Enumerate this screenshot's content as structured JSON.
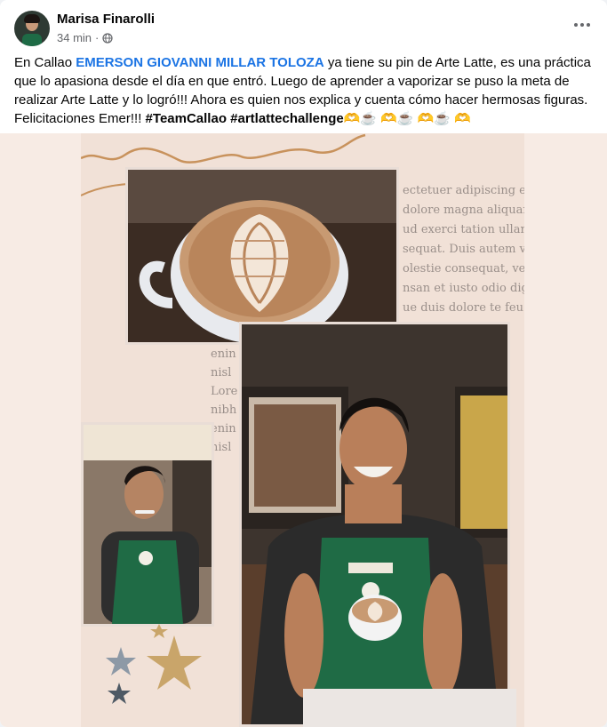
{
  "post": {
    "author": "Marisa Finarolli",
    "time": "34 min",
    "privacy_icon": "globe-icon",
    "more_icon": "more-options-icon",
    "text_before": "En Callao ",
    "mention": "EMERSON GIOVANNI MILLAR TOLOZA",
    "text_after": " ya tiene su pin de Arte Latte, es una práctica que lo apasiona desde el día en que entró. Luego de aprender a vaporizar se puso la meta de realizar Arte Latte y lo logró!!! Ahora es quien nos explica y cuenta cómo hacer hermosas figuras. Felicitaciones Emer!!! ",
    "hashtags": "#TeamCallao #artlattechallenge",
    "emojis": "🫶☕ 🫶☕ 🫶☕ 🫶"
  },
  "media": {
    "background_text": [
      "ectetuer adipiscing eli",
      "dolore magna aliquam",
      "ud exerci tation ullam",
      "sequat. Duis autem ve",
      "olestie consequat, vel",
      "nsan et iusto odio dign",
      "ue duis dolore te feu"
    ],
    "background_text_left": [
      "enin",
      "nisl",
      "Lore",
      "nibh",
      "enin",
      "nisl"
    ],
    "colors": {
      "apron_green": "#1f6b45",
      "collage_bg": "#f1e1d7",
      "mention_blue": "#1b74e4"
    }
  }
}
